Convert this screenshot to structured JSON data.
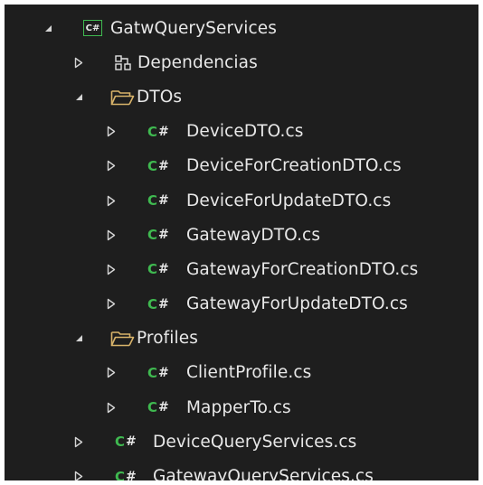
{
  "explorer": {
    "project": {
      "name": "GatwQueryServices",
      "icon": "csharp-project-icon",
      "icon_text": "C#",
      "expanded": true
    },
    "dependencies": {
      "label": "Dependencias",
      "icon": "dependencies-icon",
      "expanded": false
    },
    "dtos_folder": {
      "label": "DTOs",
      "icon": "folder-open-icon",
      "expanded": true,
      "files": [
        {
          "name": "DeviceDTO.cs"
        },
        {
          "name": "DeviceForCreationDTO.cs"
        },
        {
          "name": "DeviceForUpdateDTO.cs"
        },
        {
          "name": "GatewayDTO.cs"
        },
        {
          "name": "GatewayForCreationDTO.cs"
        },
        {
          "name": "GatewayForUpdateDTO.cs"
        }
      ]
    },
    "profiles_folder": {
      "label": "Profiles",
      "icon": "folder-open-icon",
      "expanded": true,
      "files": [
        {
          "name": "ClientProfile.cs"
        },
        {
          "name": "MapperTo.cs"
        }
      ]
    },
    "root_files": [
      {
        "name": "DeviceQueryServices.cs"
      },
      {
        "name": "GatewayQueryServices.cs"
      }
    ],
    "cs_icon_letter": "C",
    "cs_icon_hash": "#"
  },
  "colors": {
    "background": "#1e1e1e",
    "text": "#e8e8e8",
    "csharp_green": "#3fb950",
    "folder_tan": "#d8b36a",
    "arrow": "#d4d4d4"
  }
}
